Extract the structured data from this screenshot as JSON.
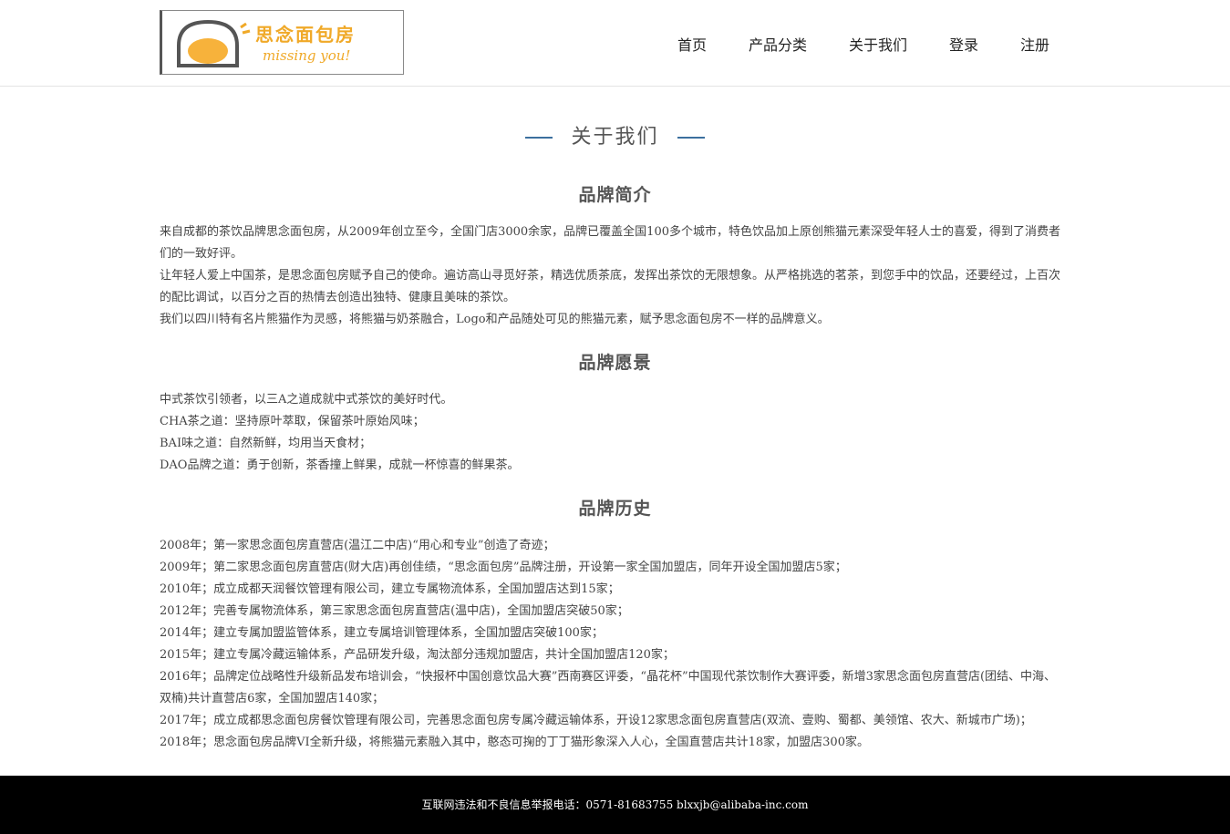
{
  "brand": {
    "name_cn": "思念面包房",
    "name_en": "missing you!",
    "color": "#f0a928"
  },
  "nav": {
    "items": [
      "首页",
      "产品分类",
      "关于我们",
      "登录",
      "注册"
    ]
  },
  "page": {
    "title": "关于我们"
  },
  "sections": {
    "intro": {
      "heading": "品牌简介",
      "lines": [
        "来自成都的茶饮品牌思念面包房，从2009年创立至今，全国门店3000余家，品牌已覆盖全国100多个城市，特色饮品加上原创熊猫元素深受年轻人士的喜爱，得到了消费者们的一致好评。",
        "让年轻人爱上中国茶，是思念面包房赋予自己的使命。遍访高山寻觅好茶，精选优质茶底，发挥出茶饮的无限想象。从严格挑选的茗茶，到您手中的饮品，还要经过，上百次的配比调试，以百分之百的热情去创造出独特、健康且美味的茶饮。",
        "我们以四川特有名片熊猫作为灵感，将熊猫与奶茶融合，Logo和产品随处可见的熊猫元素，赋予思念面包房不一样的品牌意义。"
      ]
    },
    "vision": {
      "heading": "品牌愿景",
      "lines": [
        "中式茶饮引领者，以三A之道成就中式茶饮的美好时代。",
        "CHA茶之道：坚持原叶萃取，保留茶叶原始风味；",
        "BAI味之道：自然新鲜，均用当天食材；",
        "DAO品牌之道：勇于创新，茶香撞上鲜果，成就一杯惊喜的鲜果茶。"
      ]
    },
    "history": {
      "heading": "品牌历史",
      "lines": [
        "2008年；第一家思念面包房直营店(温江二中店)“用心和专业”创造了奇迹；",
        "2009年；第二家思念面包房直营店(财大店)再创佳绩，“思念面包房”品牌注册，开设第一家全国加盟店，同年开设全国加盟店5家；",
        "2010年；成立成都天润餐饮管理有限公司，建立专属物流体系，全国加盟店达到15家；",
        "2012年；完善专属物流体系，第三家思念面包房直营店(温中店)，全国加盟店突破50家；",
        "2014年；建立专属加盟监管体系，建立专属培训管理体系，全国加盟店突破100家；",
        "2015年；建立专属冷藏运输体系，产品研发升级，淘汰部分违规加盟店，共计全国加盟店120家；",
        "2016年；品牌定位战略性升级新品发布培训会，“快报杯中国创意饮品大赛”西南赛区评委，“晶花杯”中国现代茶饮制作大赛评委，新增3家思念面包房直营店(团结、中海、双楠)共计直营店6家，全国加盟店140家；",
        "2017年；成立成都思念面包房餐饮管理有限公司，完善思念面包房专属冷藏运输体系，开设12家思念面包房直营店(双流、壹购、蜀都、美领馆、农大、新城市广场)；",
        "2018年；思念面包房品牌VI全新升级，将熊猫元素融入其中，憨态可掬的丁丁猫形象深入人心，全国直营店共计18家，加盟店300家。"
      ]
    }
  },
  "footer": {
    "text": "互联网违法和不良信息举报电话：0571-81683755 blxxjb@alibaba-inc.com"
  }
}
